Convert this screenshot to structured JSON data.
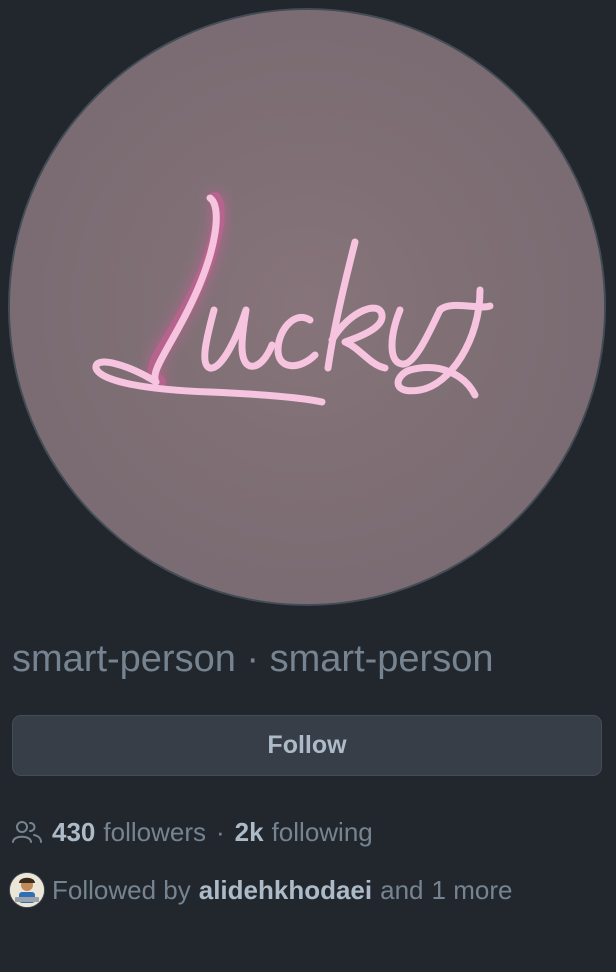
{
  "profile": {
    "avatar": {
      "logo_text": "Lucky",
      "background_color": "#7b6c71",
      "neon_color": "#f4b8d8"
    },
    "display_name": "smart-person",
    "separator": "·",
    "username": "smart-person",
    "follow_button_label": "Follow",
    "followers_count": "430",
    "followers_label": "followers",
    "stats_separator": "·",
    "following_count": "2k",
    "following_label": "following",
    "followed_by_prefix": "Followed by",
    "followed_by_user": "alidehkhodaei",
    "followed_by_conjunction": "and",
    "followed_by_more": "1 more"
  },
  "icons": {
    "people": "people-icon",
    "mini_avatar": "user-avatar-icon"
  },
  "colors": {
    "page_background": "#22272e",
    "text_muted": "#768390",
    "text_primary": "#adbac7",
    "button_background": "#373e47",
    "border": "#444c56"
  }
}
